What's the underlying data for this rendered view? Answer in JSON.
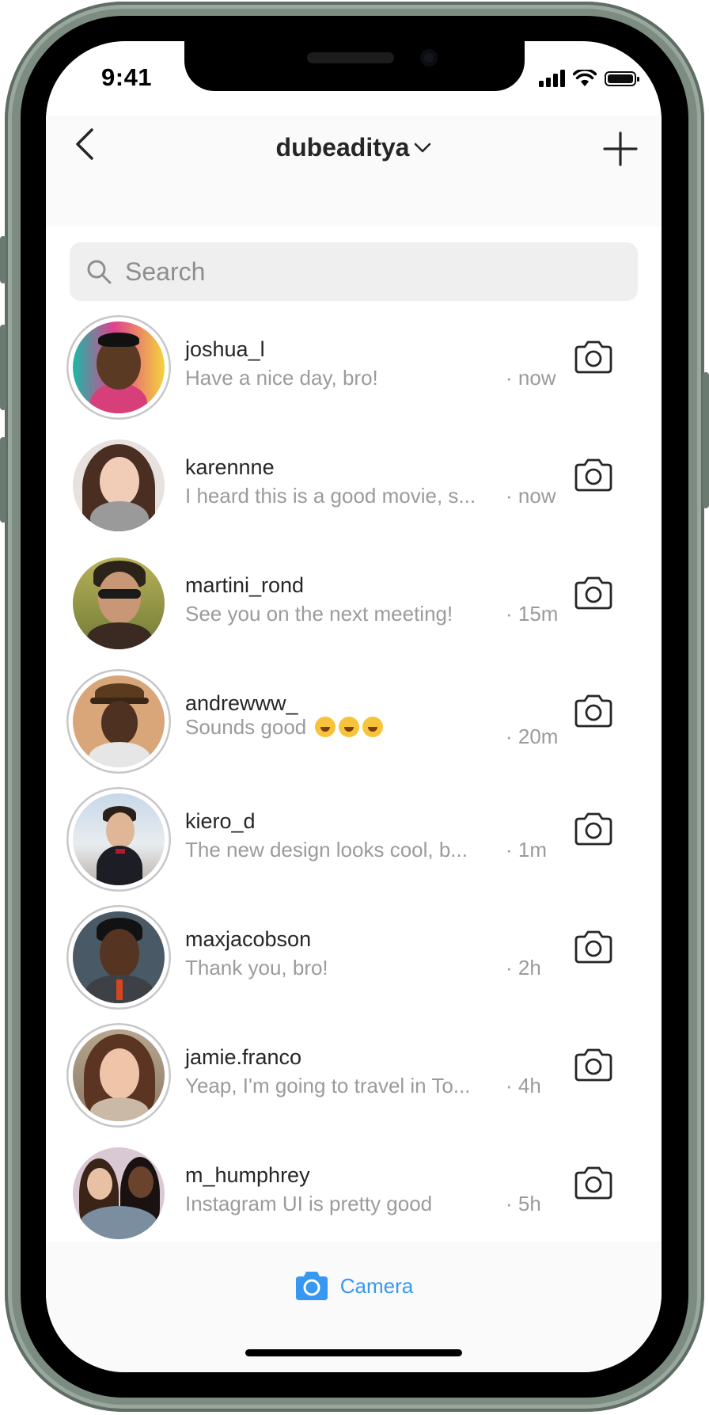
{
  "status_bar": {
    "time": "9:41"
  },
  "header": {
    "title": "dubeaditya"
  },
  "search": {
    "placeholder": "Search"
  },
  "conversations": [
    {
      "username": "joshua_l",
      "preview": "Have a nice day, bro!",
      "time": "· now",
      "has_story_ring": true
    },
    {
      "username": "karennne",
      "preview": "I heard this is a good movie, s...",
      "time": "· now",
      "has_story_ring": false
    },
    {
      "username": "martini_rond",
      "preview": "See you on the next meeting!",
      "time": "· 15m",
      "has_story_ring": false
    },
    {
      "username": "andrewww_",
      "preview": "Sounds good",
      "time": "· 20m",
      "has_story_ring": true,
      "emoji": [
        "joy-emoji",
        "joy-emoji",
        "joy-emoji"
      ]
    },
    {
      "username": "kiero_d",
      "preview": "The new design looks cool, b...",
      "time": "· 1m",
      "has_story_ring": true
    },
    {
      "username": "maxjacobson",
      "preview": "Thank you, bro!",
      "time": "· 2h",
      "has_story_ring": true
    },
    {
      "username": "jamie.franco",
      "preview": "Yeap, I'm going to travel in To...",
      "time": "· 4h",
      "has_story_ring": true
    },
    {
      "username": "m_humphrey",
      "preview": "Instagram UI is pretty good",
      "time": "· 5h",
      "has_story_ring": false
    }
  ],
  "bottom_bar": {
    "camera_label": "Camera"
  },
  "colors": {
    "accent": "#3897f0",
    "text_primary": "#262626",
    "text_secondary": "#9b9b9b",
    "frame": "#7c8c81"
  }
}
